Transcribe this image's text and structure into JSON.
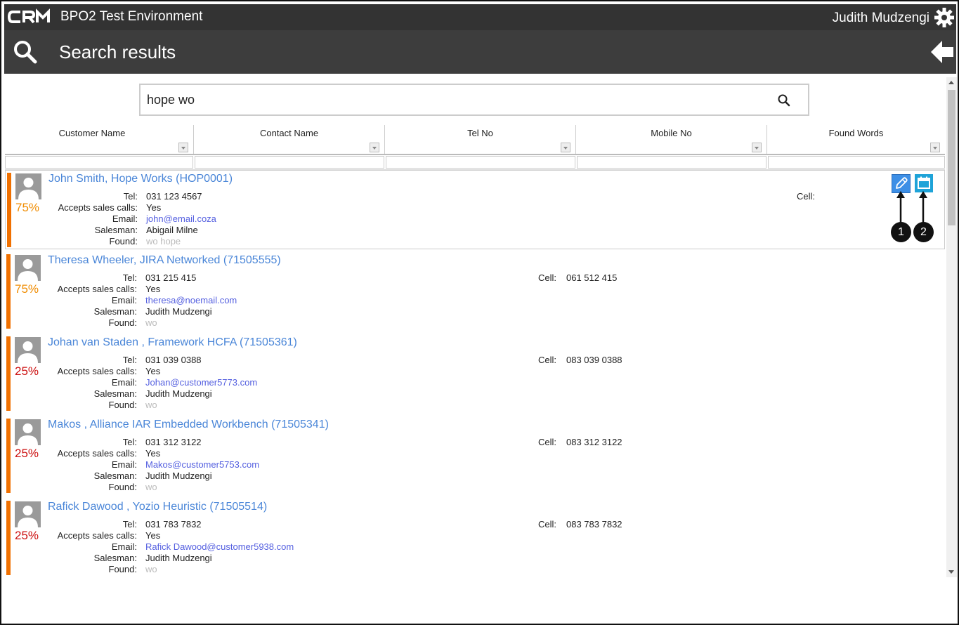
{
  "app": {
    "logo_text": "CRM",
    "env_title": "BPO2 Test Environment",
    "user_name": "Judith Mudzengi",
    "page_title": "Search results"
  },
  "search": {
    "value": "hope wo"
  },
  "columns": [
    "Customer Name",
    "Contact Name",
    "Tel No",
    "Mobile No",
    "Found Words"
  ],
  "labels": {
    "tel": "Tel:",
    "accepts": "Accepts sales calls:",
    "email": "Email:",
    "salesman": "Salesman:",
    "found": "Found:",
    "cell": "Cell:"
  },
  "results": [
    {
      "name": "John Smith, Hope Works (HOP0001)",
      "score": "75%",
      "tel": "031 123 4567",
      "accepts": "Yes",
      "email": "john@email.coza",
      "salesman": "Abigail Milne",
      "found": "wo hope",
      "cell": ""
    },
    {
      "name": "Theresa Wheeler, JIRA Networked (71505555)",
      "score": "75%",
      "tel": "031 215 415",
      "accepts": "Yes",
      "email": "theresa@noemail.com",
      "salesman": "Judith Mudzengi",
      "found": "wo",
      "cell": "061 512 415"
    },
    {
      "name": "Johan van Staden , Framework HCFA (71505361)",
      "score": "25%",
      "tel": "031 039 0388",
      "accepts": "Yes",
      "email": "Johan@customer5773.com",
      "salesman": "Judith Mudzengi",
      "found": "wo",
      "cell": "083 039 0388"
    },
    {
      "name": "Makos , Alliance IAR Embedded Workbench (71505341)",
      "score": "25%",
      "tel": "031 312 3122",
      "accepts": "Yes",
      "email": "Makos@customer5753.com",
      "salesman": "Judith Mudzengi",
      "found": "wo",
      "cell": "083 312 3122"
    },
    {
      "name": "Rafick Dawood , Yozio Heuristic (71505514)",
      "score": "25%",
      "tel": "031 783 7832",
      "accepts": "Yes",
      "email": "Rafick Dawood@customer5938.com",
      "salesman": "Judith Mudzengi",
      "found": "wo",
      "cell": "083 783 7832"
    }
  ],
  "callouts": [
    "1",
    "2"
  ],
  "colors": {
    "topbar": "#333333",
    "header": "#3d3d3d",
    "link": "#4a86d8",
    "score_high": "#f08c00",
    "score_low": "#cc1010",
    "priority_bar": "#f07000"
  }
}
